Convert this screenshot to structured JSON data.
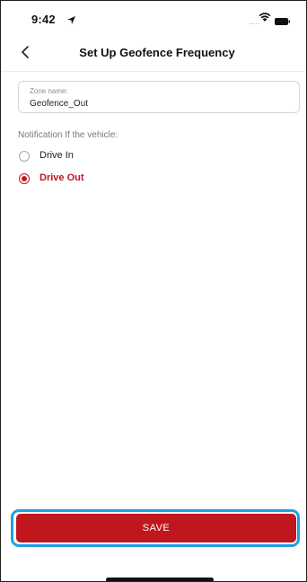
{
  "status_bar": {
    "time": "9:42",
    "location_icon": "location-arrow-icon",
    "signal_dots": "....",
    "wifi_icon": "wifi-icon",
    "battery_icon": "battery-icon"
  },
  "header": {
    "back_icon": "chevron-left-icon",
    "title": "Set Up Geofence Frequency"
  },
  "zone": {
    "label": "Zone name:",
    "value": "Geofence_Out"
  },
  "notification": {
    "label": "Notification If the vehicle:",
    "options": [
      {
        "label": "Drive In",
        "selected": false
      },
      {
        "label": "Drive Out",
        "selected": true
      }
    ]
  },
  "save": {
    "label": "SAVE"
  },
  "colors": {
    "accent": "#c0161d",
    "highlight": "#1ea0e0"
  }
}
